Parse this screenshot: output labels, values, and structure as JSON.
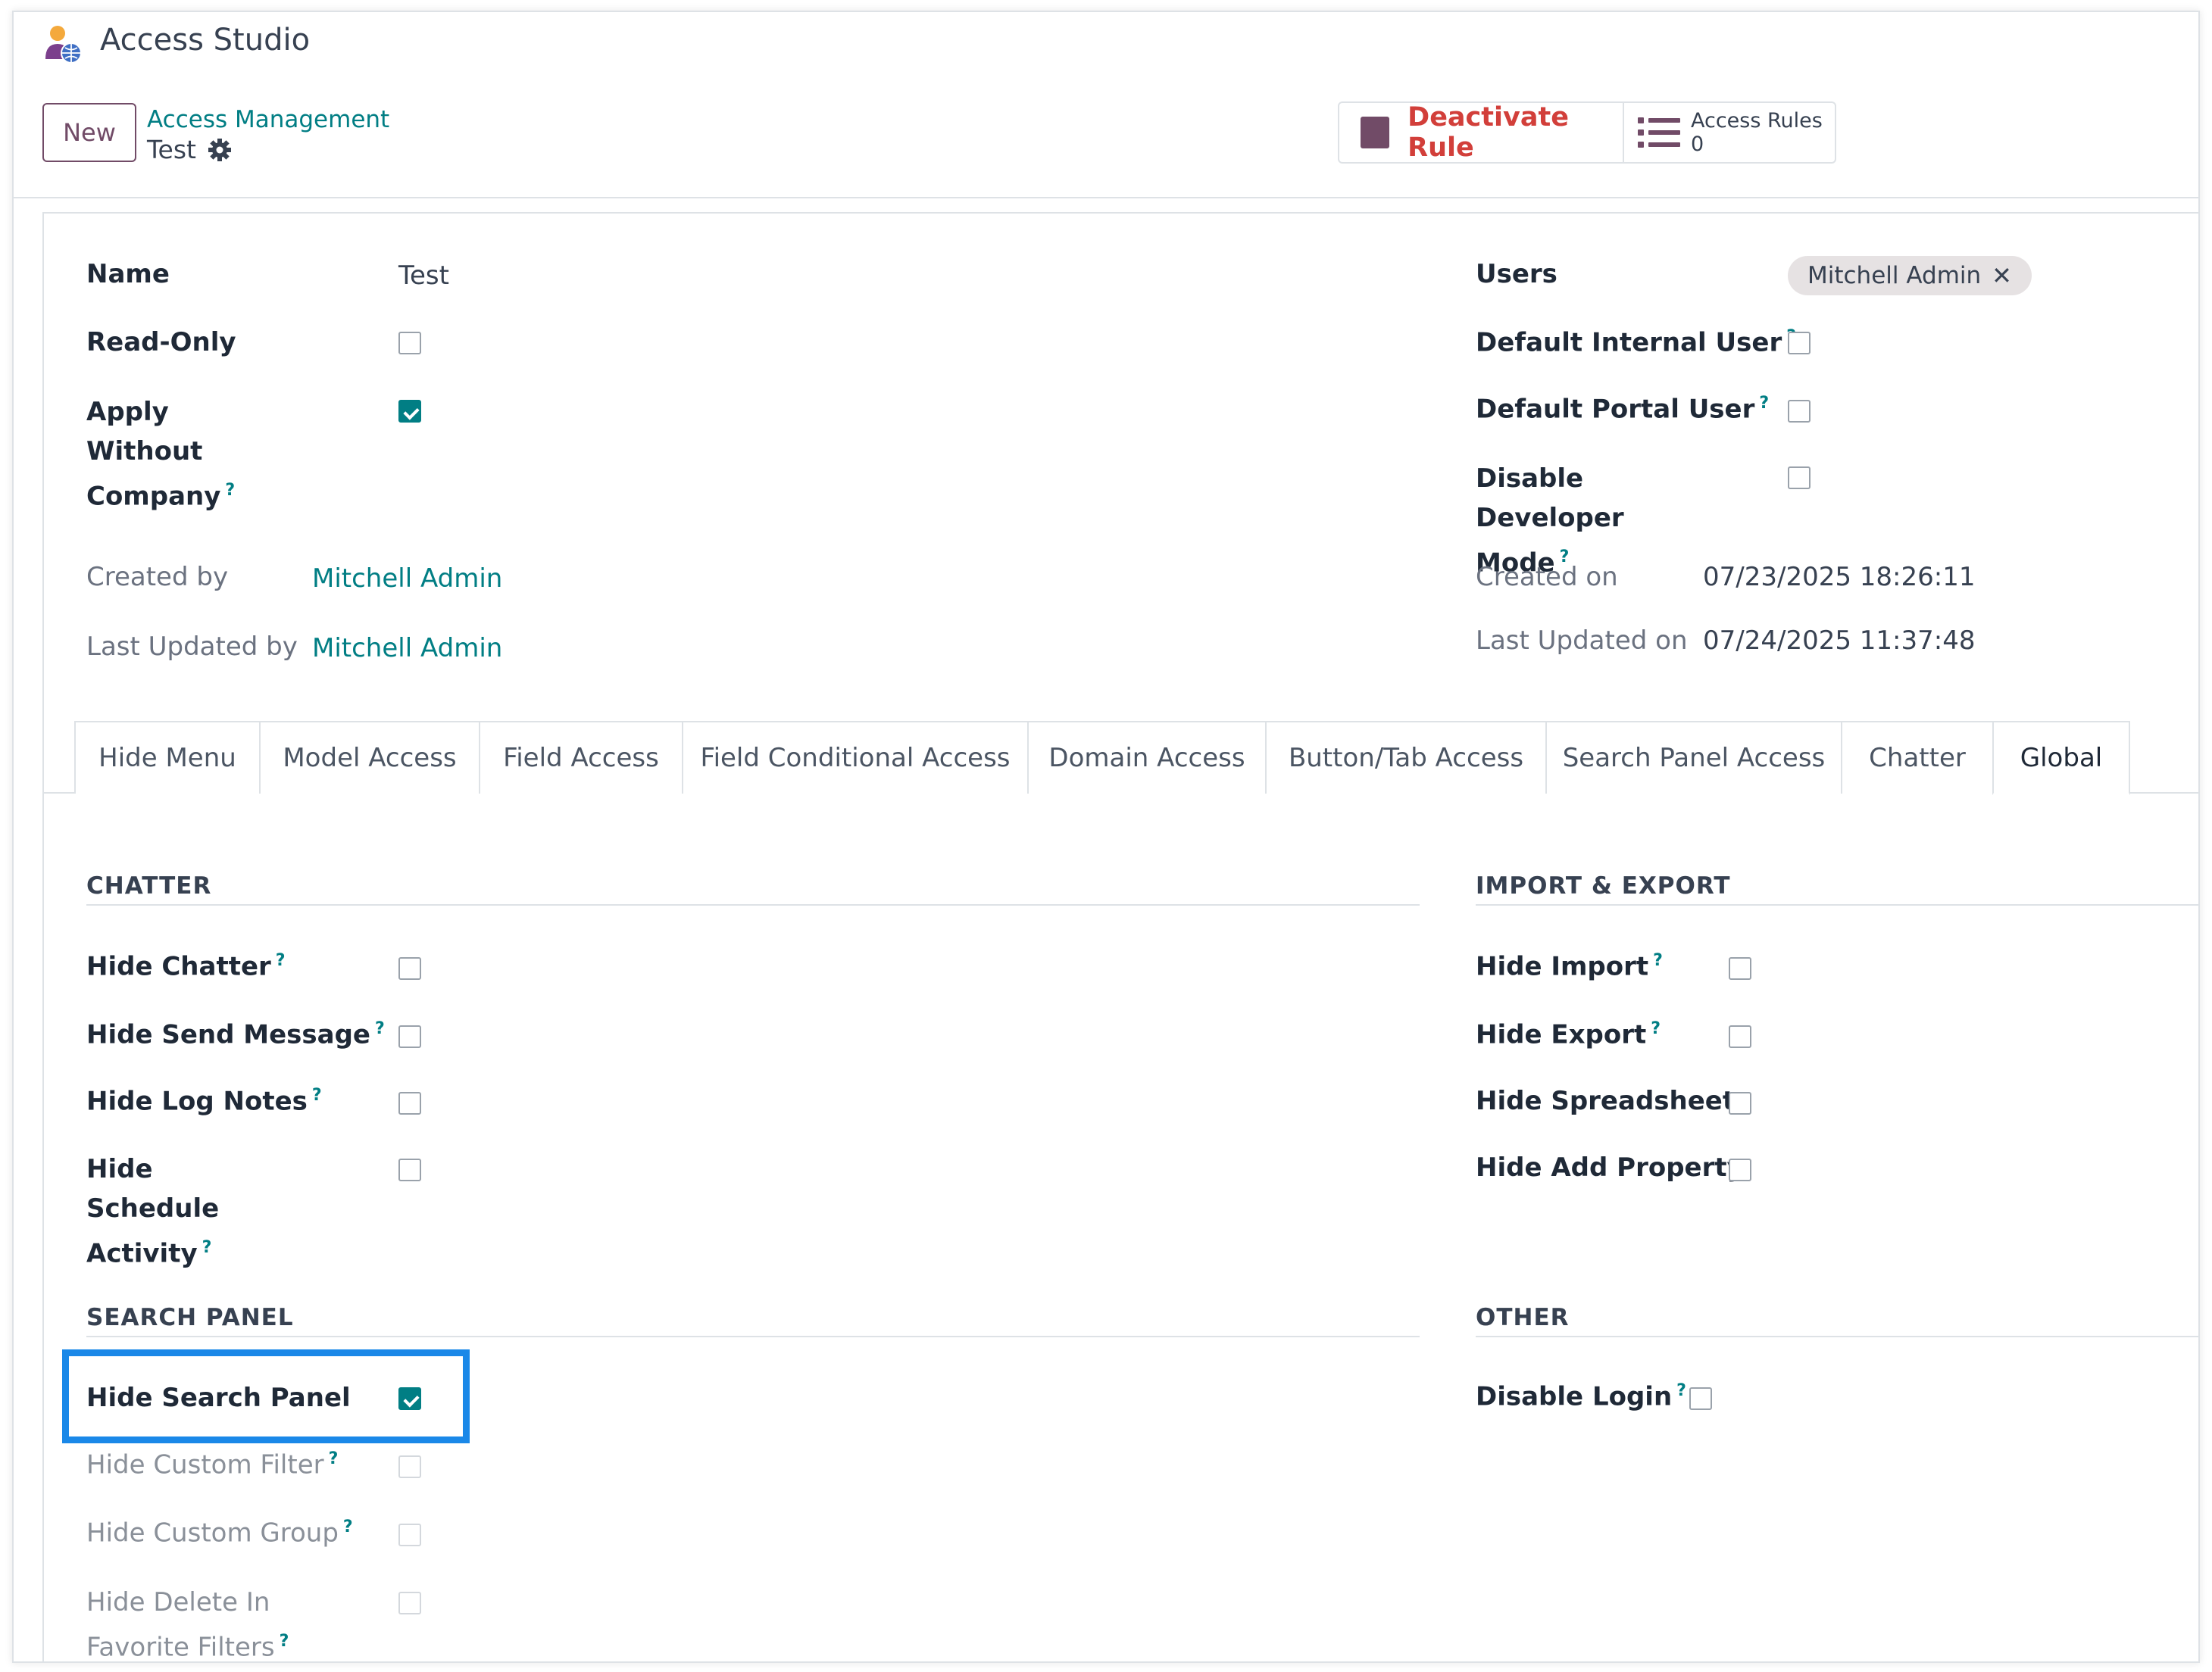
{
  "app": {
    "title": "Access Studio"
  },
  "control_panel": {
    "new_label": "New",
    "breadcrumb_parent": "Access Management",
    "breadcrumb_current": "Test",
    "deactivate_label": "Deactivate Rule",
    "access_rules_label": "Access Rules",
    "access_rules_count": "0"
  },
  "form": {
    "name": {
      "label": "Name",
      "value": "Test"
    },
    "read_only": {
      "label": "Read-Only",
      "checked": false
    },
    "apply_without_company": {
      "label": "Apply Without Company",
      "checked": true
    },
    "created_by": {
      "label": "Created by",
      "value": "Mitchell Admin"
    },
    "last_updated_by": {
      "label": "Last Updated by",
      "value": "Mitchell Admin"
    },
    "users": {
      "label": "Users",
      "tags": [
        "Mitchell Admin"
      ]
    },
    "default_internal_user": {
      "label": "Default Internal User",
      "checked": false
    },
    "default_portal_user": {
      "label": "Default Portal User",
      "checked": false
    },
    "disable_developer_mode": {
      "label": "Disable Developer Mode",
      "checked": false
    },
    "created_on": {
      "label": "Created on",
      "value": "07/23/2025 18:26:11"
    },
    "last_updated_on": {
      "label": "Last Updated on",
      "value": "07/24/2025 11:37:48"
    }
  },
  "tabs": [
    {
      "label": "Hide Menu",
      "active": false
    },
    {
      "label": "Model Access",
      "active": false
    },
    {
      "label": "Field Access",
      "active": false
    },
    {
      "label": "Field Conditional Access",
      "active": false
    },
    {
      "label": "Domain Access",
      "active": false
    },
    {
      "label": "Button/Tab Access",
      "active": false
    },
    {
      "label": "Search Panel Access",
      "active": false
    },
    {
      "label": "Chatter",
      "active": false
    },
    {
      "label": "Global",
      "active": true
    }
  ],
  "global": {
    "chatter": {
      "title": "CHATTER",
      "hide_chatter": "Hide Chatter",
      "hide_send_message": "Hide Send Message",
      "hide_log_notes": "Hide Log Notes",
      "hide_schedule_activity": "Hide Schedule Activity"
    },
    "import_export": {
      "title": "IMPORT & EXPORT",
      "hide_import": "Hide Import",
      "hide_export": "Hide Export",
      "hide_spreadsheet": "Hide Spreadsheet",
      "hide_add_property": "Hide Add Property"
    },
    "search_panel": {
      "title": "SEARCH PANEL",
      "hide_search_panel": "Hide Search Panel",
      "hide_search_panel_checked": true,
      "hide_custom_filter": "Hide Custom Filter",
      "hide_custom_group": "Hide Custom Group",
      "hide_delete_in_favorite_filters": "Hide Delete In Favorite Filters"
    },
    "other": {
      "title": "OTHER",
      "disable_login": "Disable Login"
    }
  },
  "colors": {
    "brand": "#714b67",
    "accent": "#017e84",
    "danger": "#d23f3a",
    "highlight": "#1a88e8"
  }
}
